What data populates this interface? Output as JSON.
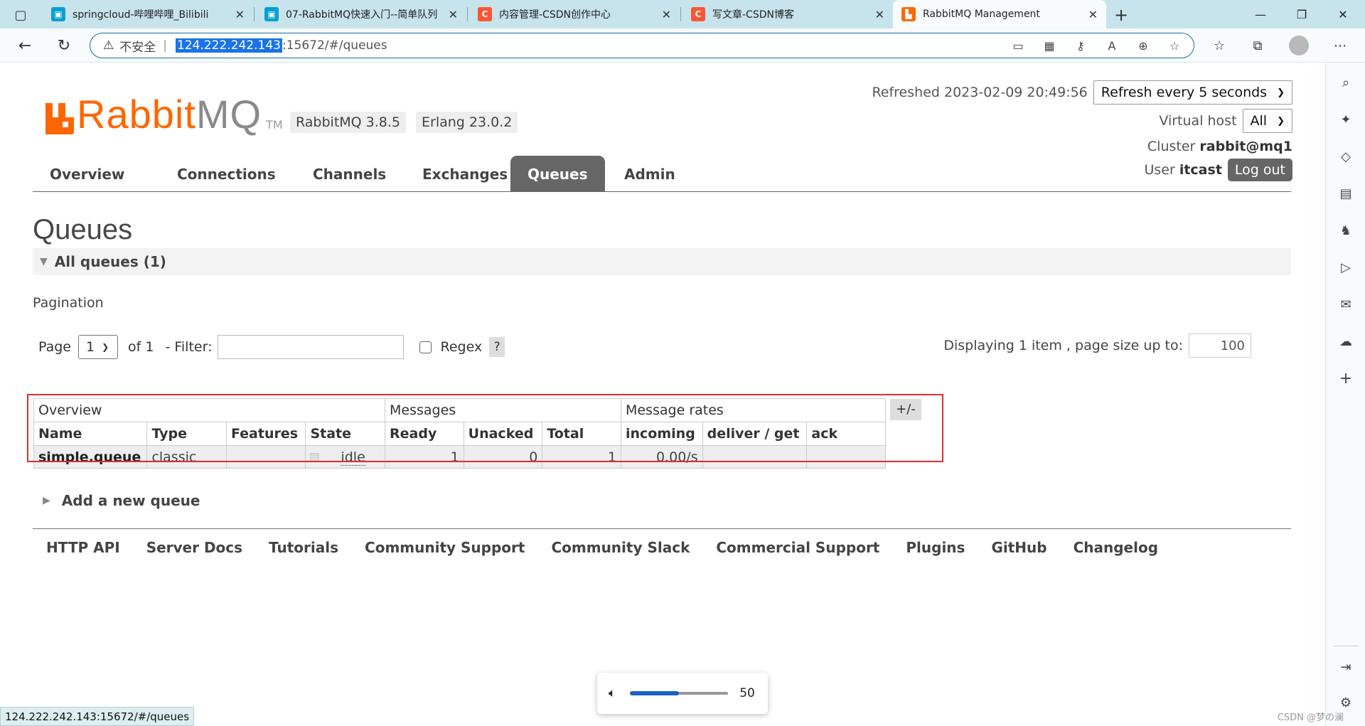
{
  "browser": {
    "tabs": [
      {
        "title": "springcloud-哔哩哔哩_Bilibili",
        "icon": "bilibili-icon",
        "color": "#00a1d6",
        "active": false
      },
      {
        "title": "07-RabbitMQ快速入门--简单队列",
        "icon": "bilibili-icon",
        "color": "#00a1d6",
        "active": false
      },
      {
        "title": "内容管理-CSDN创作中心",
        "icon": "csdn-icon",
        "color": "#fc5531",
        "active": false
      },
      {
        "title": "写文章-CSDN博客",
        "icon": "csdn-icon",
        "color": "#fc5531",
        "active": false
      },
      {
        "title": "RabbitMQ Management",
        "icon": "rabbitmq-icon",
        "color": "#f60",
        "active": true
      }
    ],
    "address": {
      "security_label": "不安全",
      "host": "124.222.242.143",
      "path": ":15672/#/queues"
    },
    "status_url": "124.222.242.143:15672/#/queues",
    "volume": {
      "value": "50",
      "level": 50
    }
  },
  "header": {
    "brand_rabbit": "Rabbit",
    "brand_mq": "MQ",
    "brand_tm": "TM",
    "rabbitmq_version": "RabbitMQ 3.8.5",
    "erlang_version": "Erlang 23.0.2",
    "refreshed_label": "Refreshed 2023-02-09 20:49:56",
    "refresh_select": "Refresh every 5 seconds",
    "vhost_label": "Virtual host",
    "vhost_value": "All",
    "cluster_label": "Cluster",
    "cluster_value": "rabbit@mq1",
    "user_label": "User",
    "user_value": "itcast",
    "logout_label": "Log out"
  },
  "nav": {
    "tabs": [
      "Overview",
      "Connections",
      "Channels",
      "Exchanges",
      "Queues",
      "Admin"
    ],
    "active": "Queues"
  },
  "page": {
    "title": "Queues",
    "section_title": "All queues (1)",
    "pagination_label": "Pagination",
    "page_label": "Page",
    "page_value": "1",
    "of_label": "of 1",
    "filter_label": "- Filter:",
    "regex_label": "Regex",
    "help_label": "?",
    "displaying_label": "Displaying 1 item , page size up to:",
    "page_size": "100",
    "add_queue_label": "Add a new queue"
  },
  "queues_table": {
    "groups": [
      "Overview",
      "Messages",
      "Message rates"
    ],
    "plus_minus": "+/-",
    "columns": [
      "Name",
      "Type",
      "Features",
      "State",
      "Ready",
      "Unacked",
      "Total",
      "incoming",
      "deliver / get",
      "ack"
    ],
    "rows": [
      {
        "name": "simple.queue",
        "type": "classic",
        "features": "",
        "state": "idle",
        "ready": "1",
        "unacked": "0",
        "total": "1",
        "incoming": "0.00/s",
        "deliver_get": "",
        "ack": ""
      }
    ]
  },
  "footer": {
    "links": [
      "HTTP API",
      "Server Docs",
      "Tutorials",
      "Community Support",
      "Community Slack",
      "Commercial Support",
      "Plugins",
      "GitHub",
      "Changelog"
    ]
  },
  "watermark": "CSDN @梦の澜"
}
